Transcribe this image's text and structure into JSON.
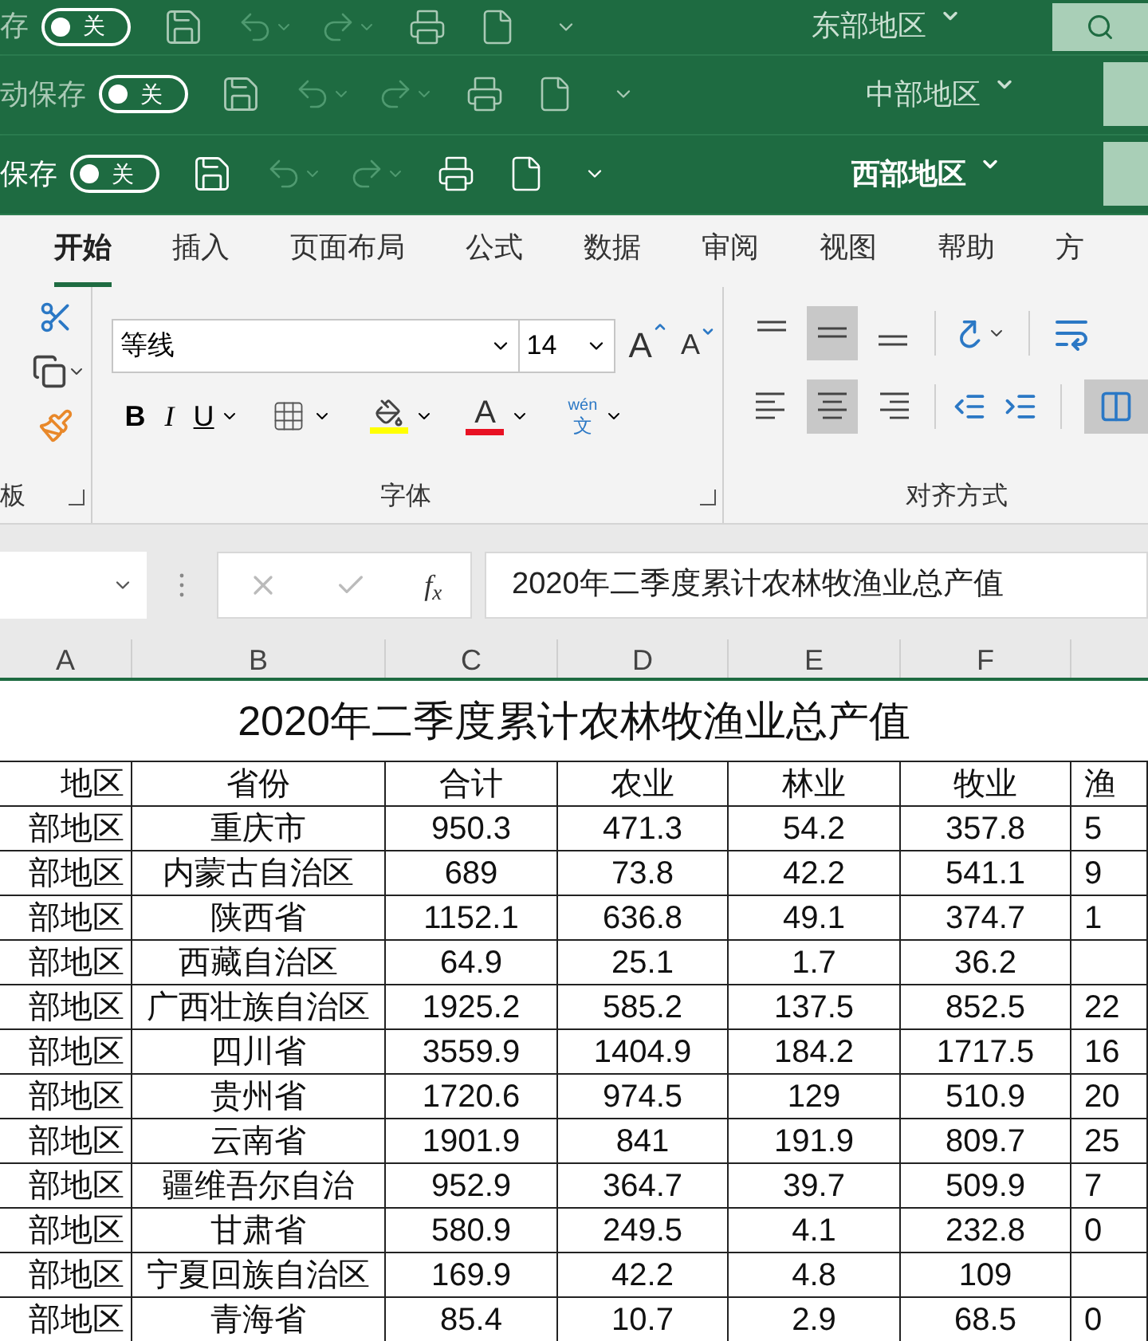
{
  "windows": [
    {
      "autosave_label": "存",
      "autosave": {
        "on": false,
        "label": "关"
      },
      "title": "东部地区",
      "active": false,
      "search": true
    },
    {
      "autosave_label": "动保存",
      "autosave": {
        "on": false,
        "label": "关"
      },
      "title": "中部地区",
      "active": false,
      "search": false
    },
    {
      "autosave_label": "保存",
      "autosave": {
        "on": false,
        "label": "关"
      },
      "title": "西部地区",
      "active": true,
      "search": false
    }
  ],
  "ribbon": {
    "tabs": [
      {
        "label": "开始",
        "selected": true
      },
      {
        "label": "插入",
        "selected": false
      },
      {
        "label": "页面布局",
        "selected": false
      },
      {
        "label": "公式",
        "selected": false
      },
      {
        "label": "数据",
        "selected": false
      },
      {
        "label": "审阅",
        "selected": false
      },
      {
        "label": "视图",
        "selected": false
      },
      {
        "label": "帮助",
        "selected": false
      },
      {
        "label": "方",
        "selected": false
      }
    ],
    "clipboard_label": "板",
    "font": {
      "name": "等线",
      "size": "14",
      "grow": "A",
      "shrink": "A",
      "bold": "B",
      "italic": "I",
      "underline": "U",
      "font_color": "A",
      "phonetic_top": "wén",
      "phonetic_bottom": "文",
      "label": "字体"
    },
    "alignment": {
      "label": "对齐方式",
      "vertical": [
        {
          "selected": false
        },
        {
          "selected": true
        },
        {
          "selected": false
        }
      ],
      "horizontal": [
        {
          "selected": false
        },
        {
          "selected": true
        },
        {
          "selected": false
        }
      ],
      "merge": {
        "selected": true
      }
    }
  },
  "formula_bar": {
    "fx": "f$_{x}$",
    "formula": "2020年二季度累计农林牧渔业总产值"
  },
  "sheet": {
    "column_headers": [
      "A",
      "B",
      "C",
      "D",
      "E",
      "F"
    ],
    "title": "2020年二季度累计农林牧渔业总产值",
    "header": [
      "地区",
      "省份",
      "合计",
      "农业",
      "林业",
      "牧业",
      "渔"
    ],
    "rows": [
      {
        "cells": [
          "部地区",
          "重庆市",
          "950.3",
          "471.3",
          "54.2",
          "357.8",
          "5"
        ]
      },
      {
        "cells": [
          "部地区",
          "内蒙古自治区",
          "689",
          "73.8",
          "42.2",
          "541.1",
          "9"
        ]
      },
      {
        "cells": [
          "部地区",
          "陕西省",
          "1152.1",
          "636.8",
          "49.1",
          "374.7",
          "1"
        ]
      },
      {
        "cells": [
          "部地区",
          "西藏自治区",
          "64.9",
          "25.1",
          "1.7",
          "36.2"
        ]
      },
      {
        "cells": [
          "部地区",
          "广西壮族自治区",
          "1925.2",
          "585.2",
          "137.5",
          "852.5",
          "22"
        ]
      },
      {
        "cells": [
          "部地区",
          "四川省",
          "3559.9",
          "1404.9",
          "184.2",
          "1717.5",
          "16"
        ]
      },
      {
        "cells": [
          "部地区",
          "贵州省",
          "1720.6",
          "974.5",
          "129",
          "510.9",
          "20"
        ]
      },
      {
        "cells": [
          "部地区",
          "云南省",
          "1901.9",
          "841",
          "191.9",
          "809.7",
          "25"
        ]
      },
      {
        "cells": [
          "部地区",
          "疆维吾尔自治",
          "952.9",
          "364.7",
          "39.7",
          "509.9",
          "7"
        ]
      },
      {
        "cells": [
          "部地区",
          "甘肃省",
          "580.9",
          "249.5",
          "4.1",
          "232.8",
          "0"
        ]
      },
      {
        "cells": [
          "部地区",
          "宁夏回族自治区",
          "169.9",
          "42.2",
          "4.8",
          "109"
        ]
      },
      {
        "cells": [
          "部地区",
          "青海省",
          "85.4",
          "10.7",
          "2.9",
          "68.5",
          "0"
        ]
      }
    ]
  }
}
